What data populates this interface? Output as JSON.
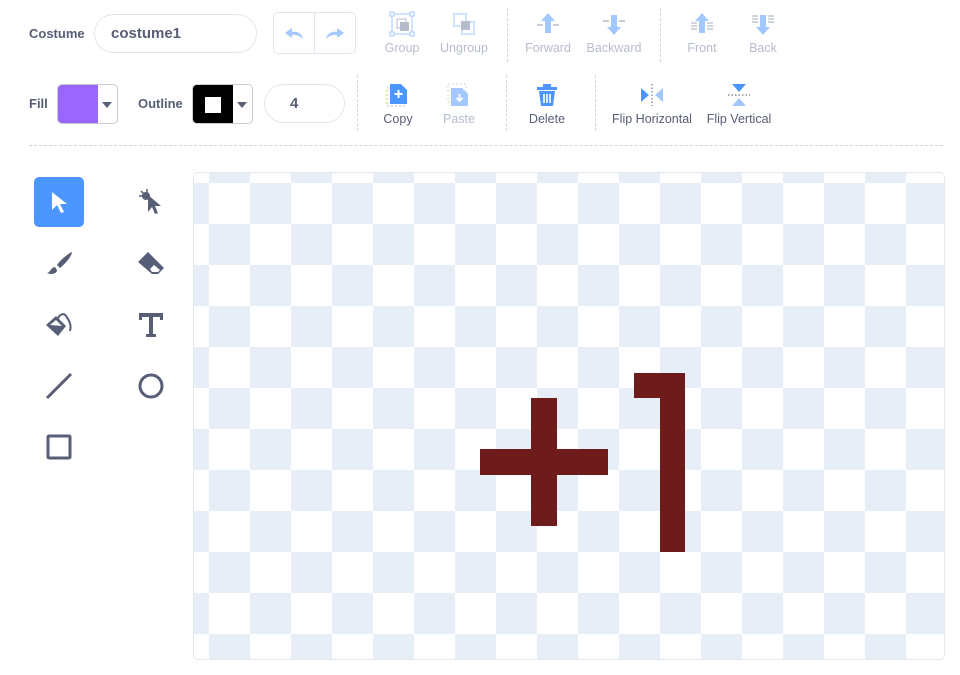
{
  "costume": {
    "label": "Costume",
    "name_value": "costume1"
  },
  "history": {
    "undo_icon": "undo-icon",
    "redo_icon": "redo-icon"
  },
  "toolbar_row1": [
    {
      "label": "Group",
      "icon": "group-icon",
      "enabled": false
    },
    {
      "label": "Ungroup",
      "icon": "ungroup-icon",
      "enabled": false
    },
    {
      "label": "Forward",
      "icon": "forward-icon",
      "enabled": false
    },
    {
      "label": "Backward",
      "icon": "backward-icon",
      "enabled": false
    },
    {
      "label": "Front",
      "icon": "front-icon",
      "enabled": false
    },
    {
      "label": "Back",
      "icon": "back-icon",
      "enabled": false
    }
  ],
  "fill": {
    "label": "Fill",
    "color": "#9966ff"
  },
  "outline": {
    "label": "Outline",
    "color": "#000000",
    "width": "4"
  },
  "toolbar_row2": [
    {
      "label": "Copy",
      "icon": "copy-icon",
      "enabled": true
    },
    {
      "label": "Paste",
      "icon": "paste-icon",
      "enabled": false
    },
    {
      "label": "Delete",
      "icon": "delete-icon",
      "enabled": true
    },
    {
      "label": "Flip Horizontal",
      "icon": "flip-horizontal-icon",
      "enabled": true
    },
    {
      "label": "Flip Vertical",
      "icon": "flip-vertical-icon",
      "enabled": true
    }
  ],
  "tools": [
    "select",
    "reshape",
    "brush",
    "eraser",
    "fill",
    "text",
    "line",
    "circle",
    "rectangle"
  ],
  "selected_tool": "select",
  "colors": {
    "accent": "#4c97ff",
    "icon": "#575e75",
    "shape": "#6e1b1b",
    "checker": "#e8eef8"
  }
}
